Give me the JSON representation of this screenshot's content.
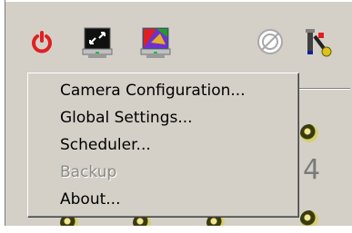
{
  "menu": {
    "items": [
      {
        "label": "Camera Configuration...",
        "enabled": true
      },
      {
        "label": "Global Settings...",
        "enabled": true
      },
      {
        "label": "Scheduler...",
        "enabled": true
      },
      {
        "label": "Backup",
        "enabled": false
      },
      {
        "label": "About...",
        "enabled": true
      }
    ]
  },
  "background": {
    "digit": "4"
  },
  "toolbar": {
    "icons": [
      "power-icon",
      "monitor-fullscreen-icon",
      "monitor-color-icon",
      "no-entry-icon",
      "tools-icon"
    ]
  },
  "colors": {
    "face": "#d4d0c8",
    "power_red": "#e02020",
    "disabled_text": "#8c8a86",
    "knob": "#d8d070"
  }
}
